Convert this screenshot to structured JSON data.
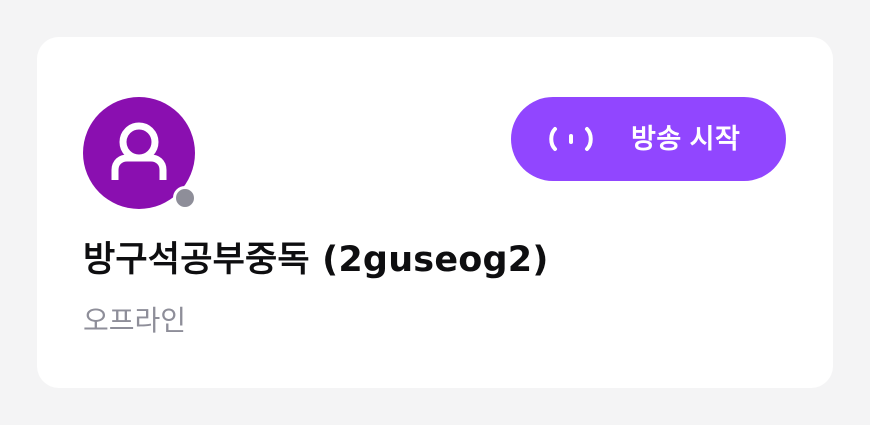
{
  "channel": {
    "display_name": "방구석공부중독 (2guseog2)",
    "status_text": "오프라인",
    "status": "offline",
    "avatar_icon": "user-icon",
    "avatar_color": "#8a0fb0",
    "status_dot_color": "#8e8e99"
  },
  "actions": {
    "start_broadcast_label": "방송 시작",
    "start_broadcast_icon": "broadcast-icon",
    "accent_color": "#9146ff"
  }
}
